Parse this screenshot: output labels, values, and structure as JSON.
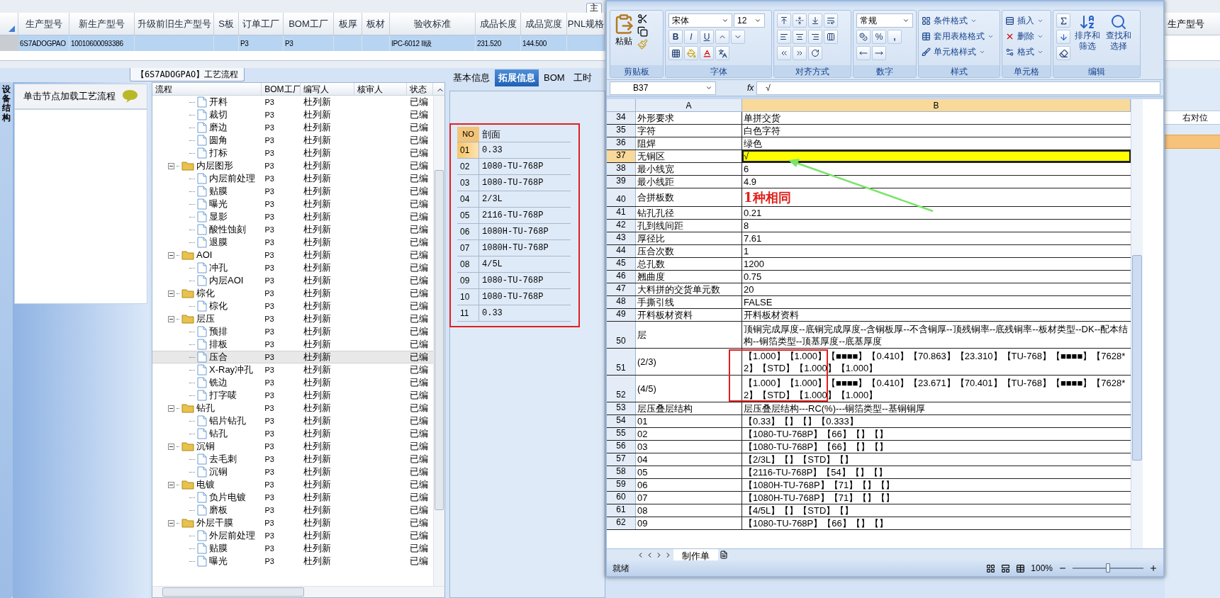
{
  "top_tab": {
    "label": "主"
  },
  "product_table": {
    "columns": [
      "生产型号",
      "新生产型号",
      "升级前旧生产型号",
      "S板",
      "订单工厂",
      "BOM工厂",
      "板厚",
      "板材",
      "验收标准",
      "成品长度",
      "成品宽度",
      "PNL规格"
    ],
    "rows": [
      {
        "selected": true,
        "cells": [
          {
            "text": "6S7ADOGPAO"
          },
          {
            "text": "10010600093386"
          },
          {},
          {},
          {
            "text": "P3"
          },
          {
            "text": "P3"
          },
          {},
          {},
          {
            "text": "IPC-6012 II级"
          },
          {
            "text": "231.520"
          },
          {
            "text": "144.500"
          },
          {}
        ]
      }
    ]
  },
  "left_panel": {
    "side_tab": "设备结构",
    "header": "单击节点加载工艺流程"
  },
  "process_flow": {
    "title": "【6S7ADOGPAO】工艺流程",
    "columns": [
      "流程",
      "BOM工厂",
      "编写人",
      "核审人",
      "状态"
    ],
    "tree": [
      {
        "kind": "continued",
        "children": [
          {
            "kind": "step",
            "label": "开料",
            "bom": "P3",
            "author": "杜列新",
            "status": "已编",
            "selected": false
          },
          {
            "kind": "step",
            "label": "裁切",
            "bom": "P3",
            "author": "杜列新",
            "status": "已编",
            "selected": false
          },
          {
            "kind": "step",
            "label": "磨边",
            "bom": "P3",
            "author": "杜列新",
            "status": "已编",
            "selected": false
          },
          {
            "kind": "step",
            "label": "圆角",
            "bom": "P3",
            "author": "杜列新",
            "status": "已编",
            "selected": false
          },
          {
            "kind": "step",
            "label": "打标",
            "bom": "P3",
            "author": "杜列新",
            "status": "已编",
            "selected": false
          }
        ]
      },
      {
        "kind": "folder",
        "label": "内层图形",
        "bom": "P3",
        "author": "杜列新",
        "status": "已编",
        "selected": false,
        "expanded": true,
        "children": [
          {
            "kind": "step",
            "label": "内层前处理",
            "bom": "P3",
            "author": "杜列新",
            "status": "已编",
            "selected": false
          },
          {
            "kind": "step",
            "label": "贴膜",
            "bom": "P3",
            "author": "杜列新",
            "status": "已编",
            "selected": false
          },
          {
            "kind": "step",
            "label": "曝光",
            "bom": "P3",
            "author": "杜列新",
            "status": "已编",
            "selected": false
          },
          {
            "kind": "step",
            "label": "显影",
            "bom": "P3",
            "author": "杜列新",
            "status": "已编",
            "selected": false
          },
          {
            "kind": "step",
            "label": "酸性蚀刻",
            "bom": "P3",
            "author": "杜列新",
            "status": "已编",
            "selected": false
          },
          {
            "kind": "step",
            "label": "退膜",
            "bom": "P3",
            "author": "杜列新",
            "status": "已编",
            "selected": false
          }
        ]
      },
      {
        "kind": "folder",
        "label": "AOI",
        "bom": "P3",
        "author": "杜列新",
        "status": "已编",
        "selected": false,
        "expanded": true,
        "children": [
          {
            "kind": "step",
            "label": "冲孔",
            "bom": "P3",
            "author": "杜列新",
            "status": "已编",
            "selected": false
          },
          {
            "kind": "step",
            "label": "内层AOI",
            "bom": "P3",
            "author": "杜列新",
            "status": "已编",
            "selected": false
          }
        ]
      },
      {
        "kind": "folder",
        "label": "棕化",
        "bom": "P3",
        "author": "杜列新",
        "status": "已编",
        "selected": false,
        "expanded": true,
        "children": [
          {
            "kind": "step",
            "label": "棕化",
            "bom": "P3",
            "author": "杜列新",
            "status": "已编",
            "selected": false
          }
        ]
      },
      {
        "kind": "folder",
        "label": "层压",
        "bom": "P3",
        "author": "杜列新",
        "status": "已编",
        "selected": false,
        "expanded": true,
        "children": [
          {
            "kind": "step",
            "label": "预排",
            "bom": "P3",
            "author": "杜列新",
            "status": "已编",
            "selected": false
          },
          {
            "kind": "step",
            "label": "排板",
            "bom": "P3",
            "author": "杜列新",
            "status": "已编",
            "selected": false
          },
          {
            "kind": "step",
            "label": "压合",
            "bom": "P3",
            "author": "杜列新",
            "status": "已编",
            "selected": true
          },
          {
            "kind": "step",
            "label": "X-Ray冲孔",
            "bom": "P3",
            "author": "杜列新",
            "status": "已编",
            "selected": false
          },
          {
            "kind": "step",
            "label": "铣边",
            "bom": "P3",
            "author": "杜列新",
            "status": "已编",
            "selected": false
          },
          {
            "kind": "step",
            "label": "打字唛",
            "bom": "P3",
            "author": "杜列新",
            "status": "已编",
            "selected": false
          }
        ]
      },
      {
        "kind": "folder",
        "label": "钻孔",
        "bom": "P3",
        "author": "杜列新",
        "status": "已编",
        "selected": false,
        "expanded": true,
        "children": [
          {
            "kind": "step",
            "label": "铝片钻孔",
            "bom": "P3",
            "author": "杜列新",
            "status": "已编",
            "selected": false
          },
          {
            "kind": "step",
            "label": "钻孔",
            "bom": "P3",
            "author": "杜列新",
            "status": "已编",
            "selected": false
          }
        ]
      },
      {
        "kind": "folder",
        "label": "沉铜",
        "bom": "P3",
        "author": "杜列新",
        "status": "已编",
        "selected": false,
        "expanded": true,
        "children": [
          {
            "kind": "step",
            "label": "去毛刺",
            "bom": "P3",
            "author": "杜列新",
            "status": "已编",
            "selected": false
          },
          {
            "kind": "step",
            "label": "沉铜",
            "bom": "P3",
            "author": "杜列新",
            "status": "已编",
            "selected": false
          }
        ]
      },
      {
        "kind": "folder",
        "label": "电镀",
        "bom": "P3",
        "author": "杜列新",
        "status": "已编",
        "selected": false,
        "expanded": true,
        "children": [
          {
            "kind": "step",
            "label": "负片电镀",
            "bom": "P3",
            "author": "杜列新",
            "status": "已编",
            "selected": false
          },
          {
            "kind": "step",
            "label": "磨板",
            "bom": "P3",
            "author": "杜列新",
            "status": "已编",
            "selected": false
          }
        ]
      },
      {
        "kind": "folder",
        "label": "外层干膜",
        "bom": "P3",
        "author": "杜列新",
        "status": "已编",
        "selected": false,
        "expanded": true,
        "children": [
          {
            "kind": "step",
            "label": "外层前处理",
            "bom": "P3",
            "author": "杜列新",
            "status": "已编",
            "selected": false
          },
          {
            "kind": "step",
            "label": "贴膜",
            "bom": "P3",
            "author": "杜列新",
            "status": "已编",
            "selected": false
          },
          {
            "kind": "step",
            "label": "曝光",
            "bom": "P3",
            "author": "杜列新",
            "status": "已编",
            "selected": false
          }
        ]
      }
    ]
  },
  "detail_panel": {
    "tabs": [
      {
        "label": "基本信息",
        "selected": false
      },
      {
        "label": "拓展信息",
        "selected": true
      },
      {
        "label": "BOM",
        "selected": false
      },
      {
        "label": "工时",
        "selected": false
      }
    ],
    "table": {
      "columns": [
        "NO",
        "剖面"
      ],
      "rows": [
        {
          "no": "01",
          "section": "0.33",
          "selected": true
        },
        {
          "no": "02",
          "section": "1080-TU-768P",
          "selected": false
        },
        {
          "no": "03",
          "section": "1080-TU-768P",
          "selected": false
        },
        {
          "no": "04",
          "section": "2/3L",
          "selected": false
        },
        {
          "no": "05",
          "section": "2116-TU-768P",
          "selected": false
        },
        {
          "no": "06",
          "section": "1080H-TU-768P",
          "selected": false
        },
        {
          "no": "07",
          "section": "1080H-TU-768P",
          "selected": false
        },
        {
          "no": "08",
          "section": "4/5L",
          "selected": false
        },
        {
          "no": "09",
          "section": "1080-TU-768P",
          "selected": false
        },
        {
          "no": "10",
          "section": "1080-TU-768P",
          "selected": false
        },
        {
          "no": "11",
          "section": "0.33",
          "selected": false
        }
      ]
    }
  },
  "right_strip": {
    "header": "生产型号",
    "grid_header": "右对位"
  },
  "excel": {
    "ribbon": {
      "paste": "粘贴",
      "font_name": "宋体",
      "font_size": "12",
      "bold": "B",
      "italic": "I",
      "underline": "U",
      "number_format": "常规",
      "percent": "%",
      "comma": ",",
      "style_buttons": [
        "条件格式",
        "套用表格格式",
        "单元格样式"
      ],
      "cell_buttons": [
        "插入",
        "删除",
        "格式"
      ],
      "edit_buttons": [
        "排序和筛选",
        "查找和选择"
      ],
      "groups": [
        "剪贴板",
        "字体",
        "对齐方式",
        "数字",
        "样式",
        "单元格",
        "编辑"
      ]
    },
    "name_box": "B37",
    "fx": "fx",
    "formula": "√",
    "columns": [
      {
        "label": "A",
        "selected": false
      },
      {
        "label": "B",
        "selected": true
      }
    ],
    "rows": [
      {
        "row": "34",
        "a": "外形要求",
        "b": "单拼交货",
        "kind": "text",
        "selected": false
      },
      {
        "row": "35",
        "a": "字符",
        "b": "白色字符",
        "kind": "text",
        "selected": false
      },
      {
        "row": "36",
        "a": "阻焊",
        "b": "绿色",
        "kind": "text",
        "selected": false
      },
      {
        "row": "37",
        "a": "无铜区",
        "b": "√",
        "kind": "text",
        "selected": true,
        "color": "#ffff00"
      },
      {
        "row": "38",
        "a": "最小线宽",
        "b": "6",
        "kind": "text",
        "selected": false
      },
      {
        "row": "39",
        "a": "最小线距",
        "b": "4.9",
        "kind": "text",
        "selected": false
      },
      {
        "row": "40",
        "a": "合拼板数",
        "b": "1种相同",
        "kind": "note",
        "selected": false
      },
      {
        "row": "41",
        "a": "钻孔孔径",
        "b": "0.21",
        "kind": "text",
        "selected": false
      },
      {
        "row": "42",
        "a": "孔到线间距",
        "b": "8",
        "kind": "text",
        "selected": false
      },
      {
        "row": "43",
        "a": "厚径比",
        "b": "7.61",
        "kind": "text",
        "selected": false
      },
      {
        "row": "44",
        "a": "压合次数",
        "b": "1",
        "kind": "text",
        "selected": false
      },
      {
        "row": "45",
        "a": "总孔数",
        "b": "1200",
        "kind": "text",
        "selected": false
      },
      {
        "row": "46",
        "a": "翘曲度",
        "b": "0.75",
        "kind": "text",
        "selected": false
      },
      {
        "row": "47",
        "a": "大料拼的交货单元数",
        "b": "20",
        "kind": "text",
        "selected": false
      },
      {
        "row": "48",
        "a": "手撕引线",
        "b": "FALSE",
        "kind": "text",
        "selected": false
      },
      {
        "row": "49",
        "a": "开料板材资料",
        "b": "开料板材资料",
        "kind": "text",
        "selected": false
      },
      {
        "row": "50",
        "a": "层",
        "b": "顶铜完成厚度--底铜完成厚度--含铜板厚--不含铜厚--顶残铜率--底残铜率--板材类型--DK--配本结构--铜箔类型--顶基厚度--底基厚度",
        "kind": "text",
        "selected": false
      },
      {
        "row": "51",
        "a": "(2/3)",
        "b": "【1.000】【1.000】【■■■■】【0.410】【70.863】【23.310】【TU-768】【■■■■】【7628*2】【STD】【1.000】【1.000】",
        "kind": "text",
        "selected": false
      },
      {
        "row": "52",
        "a": "(4/5)",
        "b": "【1.000】【1.000】【■■■■】【0.410】【23.671】【70.401】【TU-768】【■■■■】【7628*2】【STD】【1.000】【1.000】",
        "kind": "text",
        "selected": false
      },
      {
        "row": "53",
        "a": "层压叠层结构",
        "b": "层压叠层结构---RC(%)---铜箔类型--基铜铜厚",
        "kind": "text",
        "selected": false
      },
      {
        "row": "54",
        "a": "01",
        "b": "【0.33】【】【】【0.333】",
        "kind": "text",
        "selected": false
      },
      {
        "row": "55",
        "a": "02",
        "b": "【1080-TU-768P】【66】【】【】",
        "kind": "text",
        "selected": false
      },
      {
        "row": "56",
        "a": "03",
        "b": "【1080-TU-768P】【66】【】【】",
        "kind": "text",
        "selected": false
      },
      {
        "row": "57",
        "a": "04",
        "b": "【2/3L】【】【STD】【】",
        "kind": "text",
        "selected": false
      },
      {
        "row": "58",
        "a": "05",
        "b": "【2116-TU-768P】【54】【】【】",
        "kind": "text",
        "selected": false
      },
      {
        "row": "59",
        "a": "06",
        "b": "【1080H-TU-768P】【71】【】【】",
        "kind": "text",
        "selected": false
      },
      {
        "row": "60",
        "a": "07",
        "b": "【1080H-TU-768P】【71】【】【】",
        "kind": "text",
        "selected": false
      },
      {
        "row": "61",
        "a": "08",
        "b": "【4/5L】【】【STD】【】",
        "kind": "text",
        "selected": false
      },
      {
        "row": "62",
        "a": "09",
        "b": "【1080-TU-768P】【66】【】【】",
        "kind": "text",
        "selected": false
      }
    ],
    "sheet_tabs": [
      {
        "label": "制作单",
        "selected": true
      }
    ],
    "status": "就绪",
    "zoom_label": "100%",
    "zoom": {
      "level": 0.5
    }
  }
}
